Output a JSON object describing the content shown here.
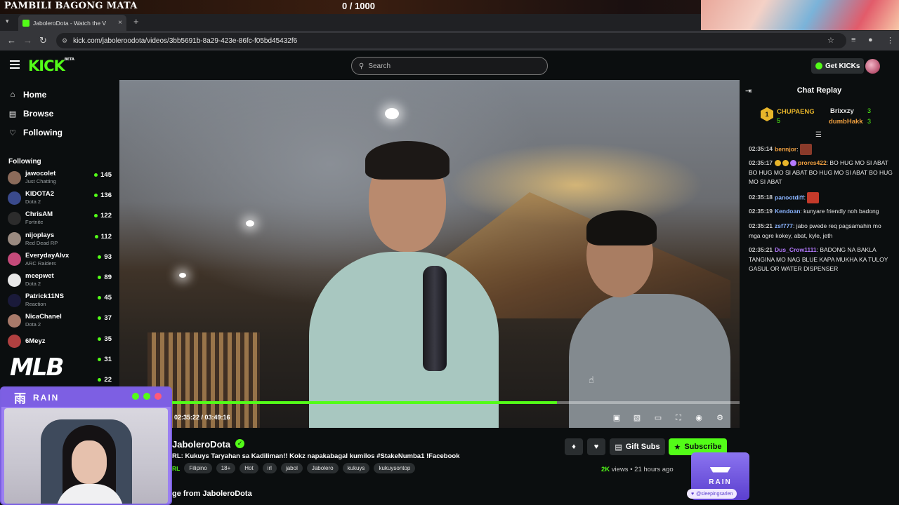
{
  "stream_overlay": {
    "marquee": "PAMBILI BAGONG MATA",
    "score": "0 / 1000"
  },
  "browser": {
    "tab_title": "JaboleroDota - Watch the V",
    "url": "kick.com/jaboleroodota/videos/3bb5691b-8a29-423e-86fc-f05bd45432f6",
    "nav": {
      "back": "←",
      "forward": "→",
      "reload": "↻"
    }
  },
  "header": {
    "logo": "KICK",
    "logo_tag": "BETA",
    "search_placeholder": "Search",
    "get_kicks_label": "Get KICKs"
  },
  "sidebar": {
    "nav": [
      {
        "label": "Home",
        "icon": "home-icon"
      },
      {
        "label": "Browse",
        "icon": "browse-icon"
      },
      {
        "label": "Following",
        "icon": "heart-icon"
      }
    ],
    "following_title": "Following",
    "channels": [
      {
        "name": "jawocolet",
        "category": "Just Chatting",
        "viewers": "145",
        "color": "#8b6b5a"
      },
      {
        "name": "KIDOTA2",
        "category": "Dota 2",
        "viewers": "136",
        "color": "#3a4a8c"
      },
      {
        "name": "ChrisAM",
        "category": "Fortnite",
        "viewers": "122",
        "color": "#2c2c2c"
      },
      {
        "name": "nijoplays",
        "category": "Red Dead RP",
        "viewers": "112",
        "color": "#9a8a80"
      },
      {
        "name": "EverydayAlvx",
        "category": "ARC Raiders",
        "viewers": "93",
        "color": "#c44a7a"
      },
      {
        "name": "meepwet",
        "category": "Dota 2",
        "viewers": "89",
        "color": "#e8e8e8"
      },
      {
        "name": "Patrick11NS",
        "category": "Reaction",
        "viewers": "45",
        "color": "#1a1a3a"
      },
      {
        "name": "NicaChanel",
        "category": "Dota 2",
        "viewers": "37",
        "color": "#a87a6a"
      },
      {
        "name": "6Meyz",
        "category": "",
        "viewers": "35",
        "color": "#b04040"
      },
      {
        "name": "",
        "category": "",
        "viewers": "31",
        "color": "#0b0e0f"
      },
      {
        "name": "",
        "category": "",
        "viewers": "22",
        "color": "#0b0e0f"
      }
    ]
  },
  "player": {
    "current_time": "02:35:22",
    "duration": "03:49:16",
    "time_display": "02:35:22 / 03:49:16",
    "progress": 0.678
  },
  "video_info": {
    "channel": "JaboleroDota",
    "title": "RL: Kukuys Taryahan sa Kadiliman!! Kokz napakabagal kumilos #StakeNumba1 !Facebook",
    "category": "RL",
    "tags": [
      "Filipino",
      "18+",
      "Hot",
      "irl",
      "jabol",
      "Jabolero",
      "kukuys",
      "kukuysontop"
    ],
    "gift_subs_label": "Gift Subs",
    "subscribe_label": "Subscribe",
    "views_count": "2K",
    "views_label": "views",
    "time_ago": "21 hours ago",
    "more_from": "ge from JaboleroDota"
  },
  "chat": {
    "title": "Chat Replay",
    "leaderboard": [
      {
        "rank": "1",
        "name": "CHUPAENG",
        "value": "5",
        "color": "#e8b52a"
      },
      {
        "name": "Brixxzy",
        "value": "3",
        "color": "#e6e6e6"
      },
      {
        "name": "dumbHakk",
        "value": "3",
        "color": "#f0a040"
      }
    ],
    "messages": [
      {
        "time": "02:35:14",
        "user": "bennjor",
        "user_color": "#f0a040",
        "text": ""
      },
      {
        "time": "02:35:17",
        "user": "prores422",
        "user_color": "#f0a040",
        "text": "BO HUG MO SI ABAT BO HUG MO SI ABAT BO HUG MO SI ABAT BO HUG MO SI ABAT"
      },
      {
        "time": "02:35:18",
        "user": "panootdiff",
        "user_color": "#8ab4ff",
        "text": ""
      },
      {
        "time": "02:35:19",
        "user": "Kendoan",
        "user_color": "#8ab4ff",
        "text": "kunyare friendly noh badong"
      },
      {
        "time": "02:35:21",
        "user": "zsf777",
        "user_color": "#8ab4ff",
        "text": "jabo pwede req pagsamahin mo mga ogre kokey, abat, kyle, jeth"
      },
      {
        "time": "02:35:21",
        "user": "Dus_Crow1111",
        "user_color": "#b57aff",
        "text": "BADONG NA BAKLA TANGINA MO NAG BLUE KAPA MUKHA KA TULOY GASUL OR WATER DISPENSER"
      }
    ]
  },
  "facecam": {
    "title_cn": "雨",
    "brand": "RAIN",
    "social_handle": "@sleepingsarlen"
  },
  "overlay_logo": "MLB"
}
